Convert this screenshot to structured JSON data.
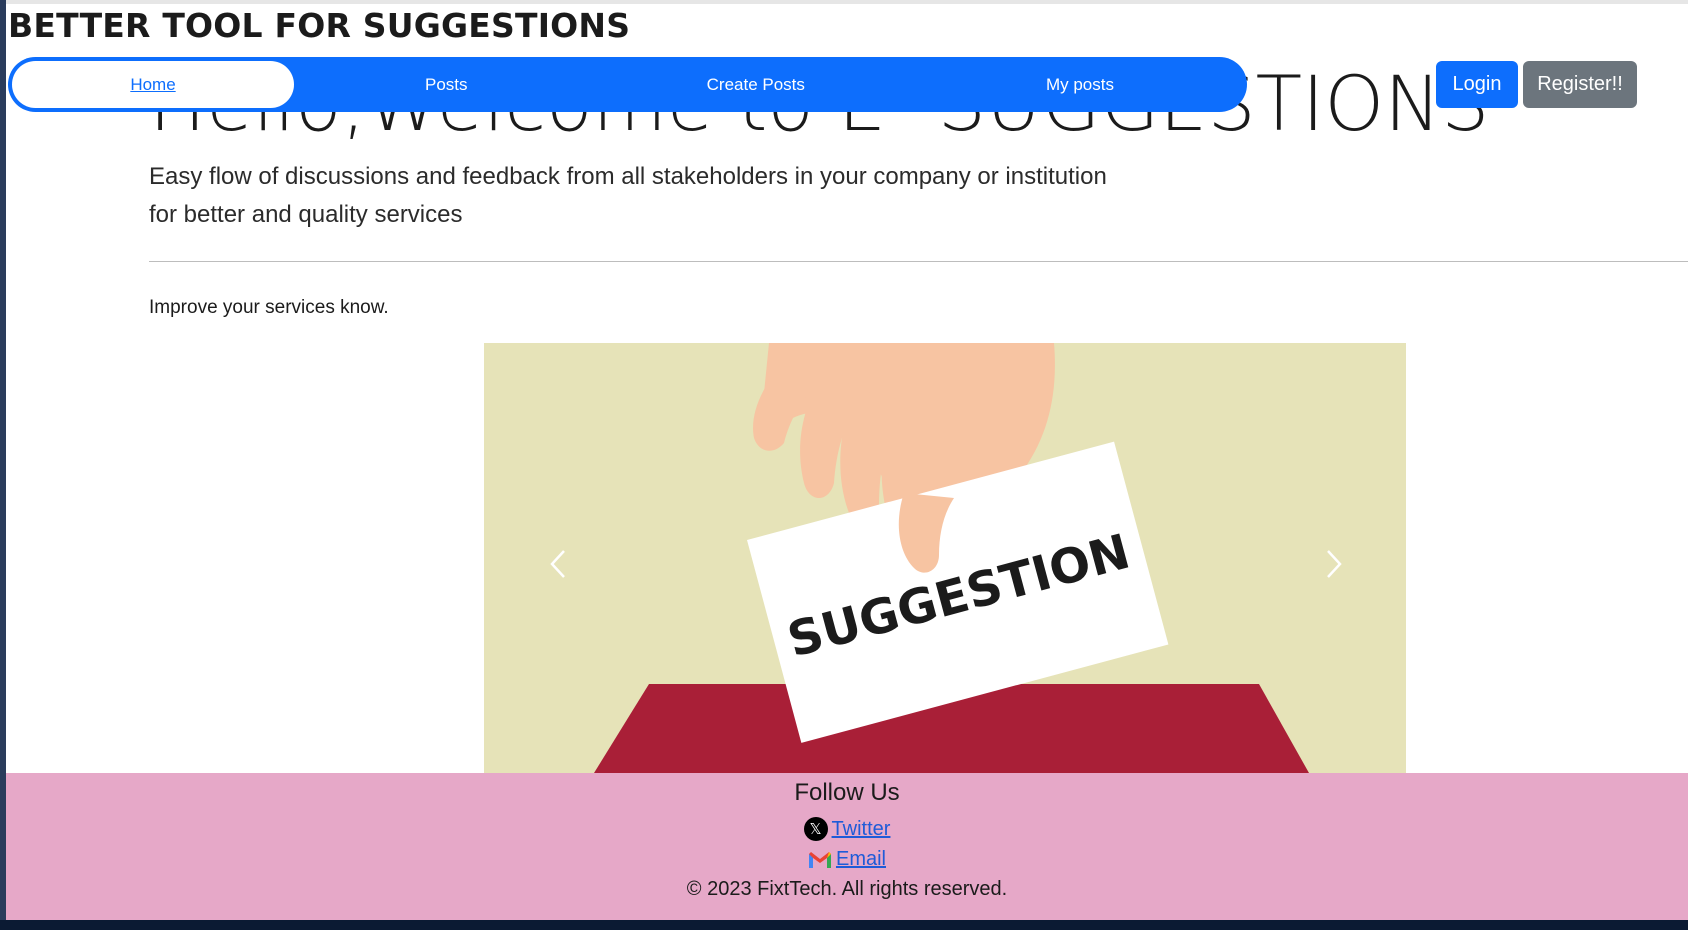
{
  "site": {
    "title": "BETTER TOOL FOR SUGGESTIONS"
  },
  "nav": {
    "items": [
      {
        "label": "Home",
        "active": true
      },
      {
        "label": "Posts"
      },
      {
        "label": "Create Posts"
      },
      {
        "label": "My posts"
      }
    ],
    "login_label": "Login",
    "register_label": "Register!!"
  },
  "hero": {
    "heading": "Hello,Welcome to E- SUGGESTIONS",
    "lead": "Easy flow of discussions and feedback from all stakeholders in your company or institution for better and quality services",
    "sub_text": "Improve your services know."
  },
  "carousel": {
    "card_text": "SUGGESTION",
    "prev_icon": "chevron-left-icon",
    "next_icon": "chevron-right-icon"
  },
  "footer": {
    "heading": "Follow Us",
    "twitter_label": " Twitter",
    "email_label": " Email",
    "copyright": "© 2023 FixtTech. All rights reserved."
  },
  "colors": {
    "primary": "#0d6efd",
    "secondary": "#6c757d",
    "footer_bg": "#e6a8c8",
    "carousel_bg": "#e6e3b8",
    "ballot_box": "#a91f37",
    "hand": "#f7c4a2"
  }
}
